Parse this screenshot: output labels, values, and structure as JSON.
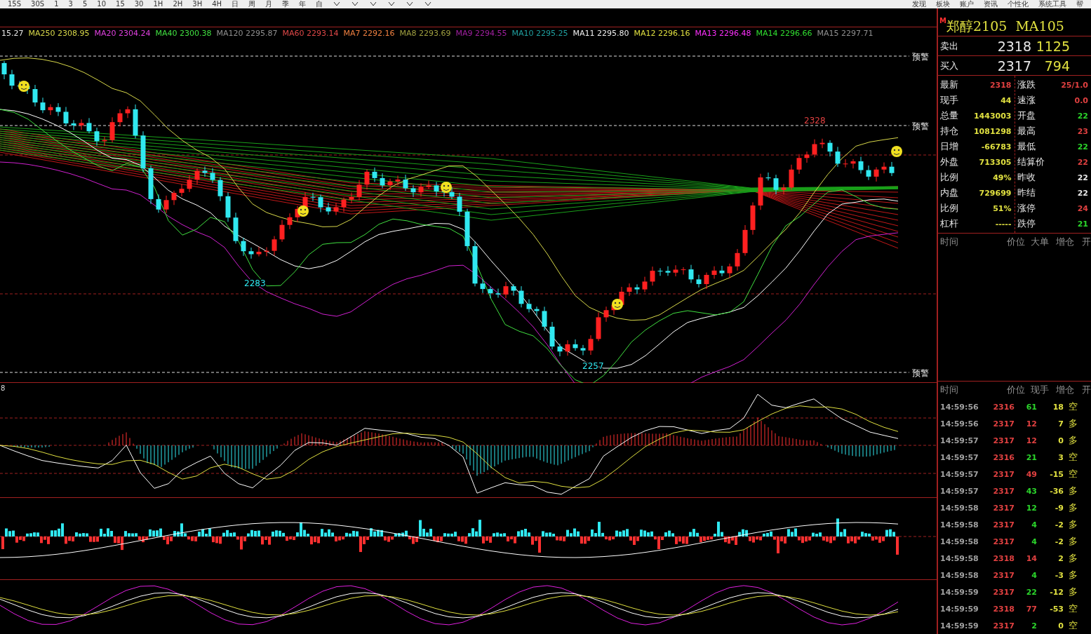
{
  "toolbar": {
    "periods": [
      "15S",
      "30S",
      "1",
      "3",
      "5",
      "10",
      "15",
      "30",
      "1H",
      "2H",
      "3H",
      "4H",
      "日",
      "周",
      "月",
      "季",
      "年",
      "自"
    ],
    "menu": [
      "发现",
      "板块",
      "账户",
      "资讯",
      "个性化",
      "系统工具",
      "帮"
    ]
  },
  "legend": [
    {
      "label": "15.27",
      "color": "#e8e8e8"
    },
    {
      "label": "MA250 2308.95",
      "color": "#d8d84a"
    },
    {
      "label": "MA20 2304.24",
      "color": "#e040e0"
    },
    {
      "label": "MA40 2300.38",
      "color": "#40e040"
    },
    {
      "label": "MA120 2295.87",
      "color": "#909090"
    },
    {
      "label": "MA60 2293.14",
      "color": "#e04848"
    },
    {
      "label": "MA7 2292.16",
      "color": "#f08040"
    },
    {
      "label": "MA8 2293.69",
      "color": "#a0a040"
    },
    {
      "label": "MA9 2294.55",
      "color": "#a020a0"
    },
    {
      "label": "MA10 2295.25",
      "color": "#20a0a0"
    },
    {
      "label": "MA11 2295.80",
      "color": "#f0f0f0"
    },
    {
      "label": "MA12 2296.16",
      "color": "#e0e040"
    },
    {
      "label": "MA13 2296.48",
      "color": "#ff30ff"
    },
    {
      "label": "MA14 2296.66",
      "color": "#30e030"
    },
    {
      "label": "MA15 2297.71",
      "color": "#909090"
    }
  ],
  "main_chart": {
    "alert_labels": [
      "预警",
      "预警",
      "预警"
    ],
    "price_labels": [
      "2283",
      "2257",
      "2328"
    ]
  },
  "macd_panel": {
    "label": "8"
  },
  "quote": {
    "title_mark": "M",
    "title": "郑醇2105  MA105",
    "sell": {
      "label": "卖出",
      "price": "2318",
      "volume": "1125"
    },
    "buy": {
      "label": "买入",
      "price": "2317",
      "volume": "794"
    },
    "left_stats": [
      {
        "label": "最新",
        "value": "2318",
        "color": "#e04040"
      },
      {
        "label": "现手",
        "value": "44",
        "color": "#e0e040"
      },
      {
        "label": "总量",
        "value": "1443003",
        "color": "#e0e040"
      },
      {
        "label": "持仓",
        "value": "1081298",
        "color": "#e0e040"
      },
      {
        "label": "日增",
        "value": "-66783",
        "color": "#e0e040"
      },
      {
        "label": "外盘",
        "value": "713305",
        "color": "#e0e040"
      },
      {
        "label": "比例",
        "value": "49%",
        "color": "#e0e040"
      },
      {
        "label": "内盘",
        "value": "729699",
        "color": "#e0e040"
      },
      {
        "label": "比例",
        "value": "51%",
        "color": "#e0e040"
      },
      {
        "label": "杠杆",
        "value": "-----",
        "color": "#e0e040"
      }
    ],
    "right_stats": [
      {
        "label": "涨跌",
        "value": "25/1.0",
        "color": "#e04040"
      },
      {
        "label": "速涨",
        "value": "0.0",
        "color": "#e04040"
      },
      {
        "label": "开盘",
        "value": "22",
        "color": "#2bd52b"
      },
      {
        "label": "最高",
        "value": "23",
        "color": "#e04040"
      },
      {
        "label": "最低",
        "value": "22",
        "color": "#2bd52b"
      },
      {
        "label": "结算价",
        "value": "22",
        "color": "#e04040"
      },
      {
        "label": "昨收",
        "value": "22",
        "color": "#e8e8e8"
      },
      {
        "label": "昨结",
        "value": "22",
        "color": "#e8e8e8"
      },
      {
        "label": "涨停",
        "value": "24",
        "color": "#e04040"
      },
      {
        "label": "跌停",
        "value": "21",
        "color": "#2bd52b"
      }
    ],
    "tick_header": [
      "时间",
      "价位",
      "大单",
      "增仓",
      "开"
    ]
  },
  "trades": {
    "columns": [
      "时间",
      "价位",
      "现手",
      "增仓",
      "开"
    ],
    "rows": [
      {
        "time": "14:59:56",
        "price": "2316",
        "hand": "61",
        "change": "18",
        "type": "空",
        "color": "#2bd52b"
      },
      {
        "time": "14:59:56",
        "price": "2317",
        "hand": "12",
        "change": "7",
        "type": "多",
        "color": "#e04040"
      },
      {
        "time": "14:59:57",
        "price": "2317",
        "hand": "12",
        "change": "0",
        "type": "多",
        "color": "#e04040"
      },
      {
        "time": "14:59:57",
        "price": "2316",
        "hand": "21",
        "change": "3",
        "type": "空",
        "color": "#2bd52b"
      },
      {
        "time": "14:59:57",
        "price": "2317",
        "hand": "49",
        "change": "-15",
        "type": "空",
        "color": "#e04040"
      },
      {
        "time": "14:59:57",
        "price": "2317",
        "hand": "43",
        "change": "-36",
        "type": "多",
        "color": "#2bd52b"
      },
      {
        "time": "14:59:58",
        "price": "2317",
        "hand": "12",
        "change": "-9",
        "type": "多",
        "color": "#2bd52b"
      },
      {
        "time": "14:59:58",
        "price": "2317",
        "hand": "4",
        "change": "-2",
        "type": "多",
        "color": "#2bd52b"
      },
      {
        "time": "14:59:58",
        "price": "2317",
        "hand": "4",
        "change": "-2",
        "type": "多",
        "color": "#2bd52b"
      },
      {
        "time": "14:59:58",
        "price": "2318",
        "hand": "14",
        "change": "2",
        "type": "多",
        "color": "#e04040"
      },
      {
        "time": "14:59:58",
        "price": "2317",
        "hand": "4",
        "change": "-3",
        "type": "多",
        "color": "#2bd52b"
      },
      {
        "time": "14:59:59",
        "price": "2317",
        "hand": "22",
        "change": "-12",
        "type": "多",
        "color": "#2bd52b"
      },
      {
        "time": "14:59:59",
        "price": "2318",
        "hand": "77",
        "change": "-53",
        "type": "空",
        "color": "#e04040"
      },
      {
        "time": "14:59:59",
        "price": "2317",
        "hand": "2",
        "change": "0",
        "type": "空",
        "color": "#2bd52b"
      }
    ]
  }
}
